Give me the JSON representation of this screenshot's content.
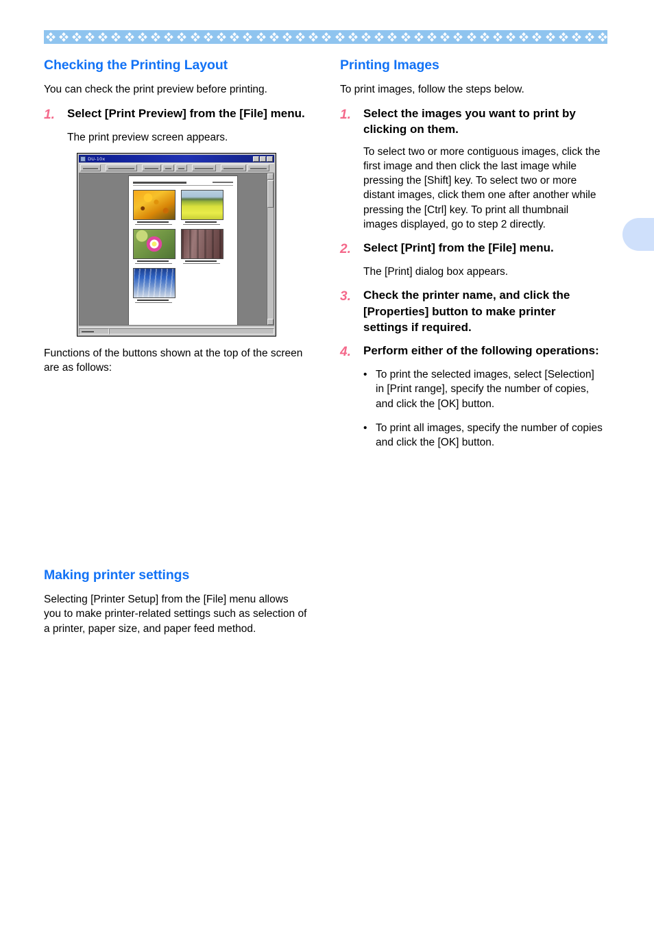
{
  "header": {
    "motif_count": 44,
    "band_color": "#8fc4ef",
    "motif_color": "#ffffff"
  },
  "theme": {
    "heading_blue": "#1272f5",
    "step_number_pink": "#f4688a",
    "tab_blue": "#cfe0fb"
  },
  "left_column": {
    "section_title": "Checking the Printing Layout",
    "intro": "You can check the print preview before printing.",
    "step1": {
      "number": "1.",
      "title": "Select [Print Preview] from the [File] menu.",
      "body": "The print preview screen appears."
    },
    "screenshot": {
      "window_title": "DU-10x",
      "toolbar_buttons": 8,
      "thumbnails": [
        "marigold-flowers-photo",
        "rapeseed-field-photo",
        "pink-flower-photo",
        "brown-building-photo",
        "blue-tower-photo"
      ],
      "window_controls": [
        "minimize",
        "maximize",
        "close"
      ],
      "scrollbar": "vertical"
    },
    "after_screenshot": "Functions of the buttons shown at the top of the screen are as follows:",
    "section2_title": "Making printer settings",
    "section2_body": "Selecting [Printer Setup] from the [File] menu allows you to make printer-related settings such as selection of a printer, paper size, and paper feed method."
  },
  "right_column": {
    "section_title": "Printing Images",
    "intro": "To print images, follow the steps below.",
    "steps": [
      {
        "number": "1.",
        "title": "Select the images you want to print by clicking on them.",
        "body": "To select two or more contiguous images, click the first image and then click the last image while pressing the [Shift] key. To select two or more distant images, click them one after another while pressing the [Ctrl] key. To print all thumbnail images displayed, go to step 2 directly."
      },
      {
        "number": "2.",
        "title": "Select [Print] from the [File] menu.",
        "body": "The [Print] dialog box appears."
      },
      {
        "number": "3.",
        "title": "Check the printer name, and click the [Properties] button to make printer settings if required.",
        "body": ""
      },
      {
        "number": "4.",
        "title": "Perform either of the following operations:",
        "body": ""
      }
    ],
    "bullets": [
      {
        "dot": "•",
        "text": "To print the selected images, select [Selection] in [Print range], specify the number of copies, and click the [OK] button."
      },
      {
        "dot": "•",
        "text": "To print all images, specify the number of copies and click the [OK] button."
      }
    ]
  }
}
